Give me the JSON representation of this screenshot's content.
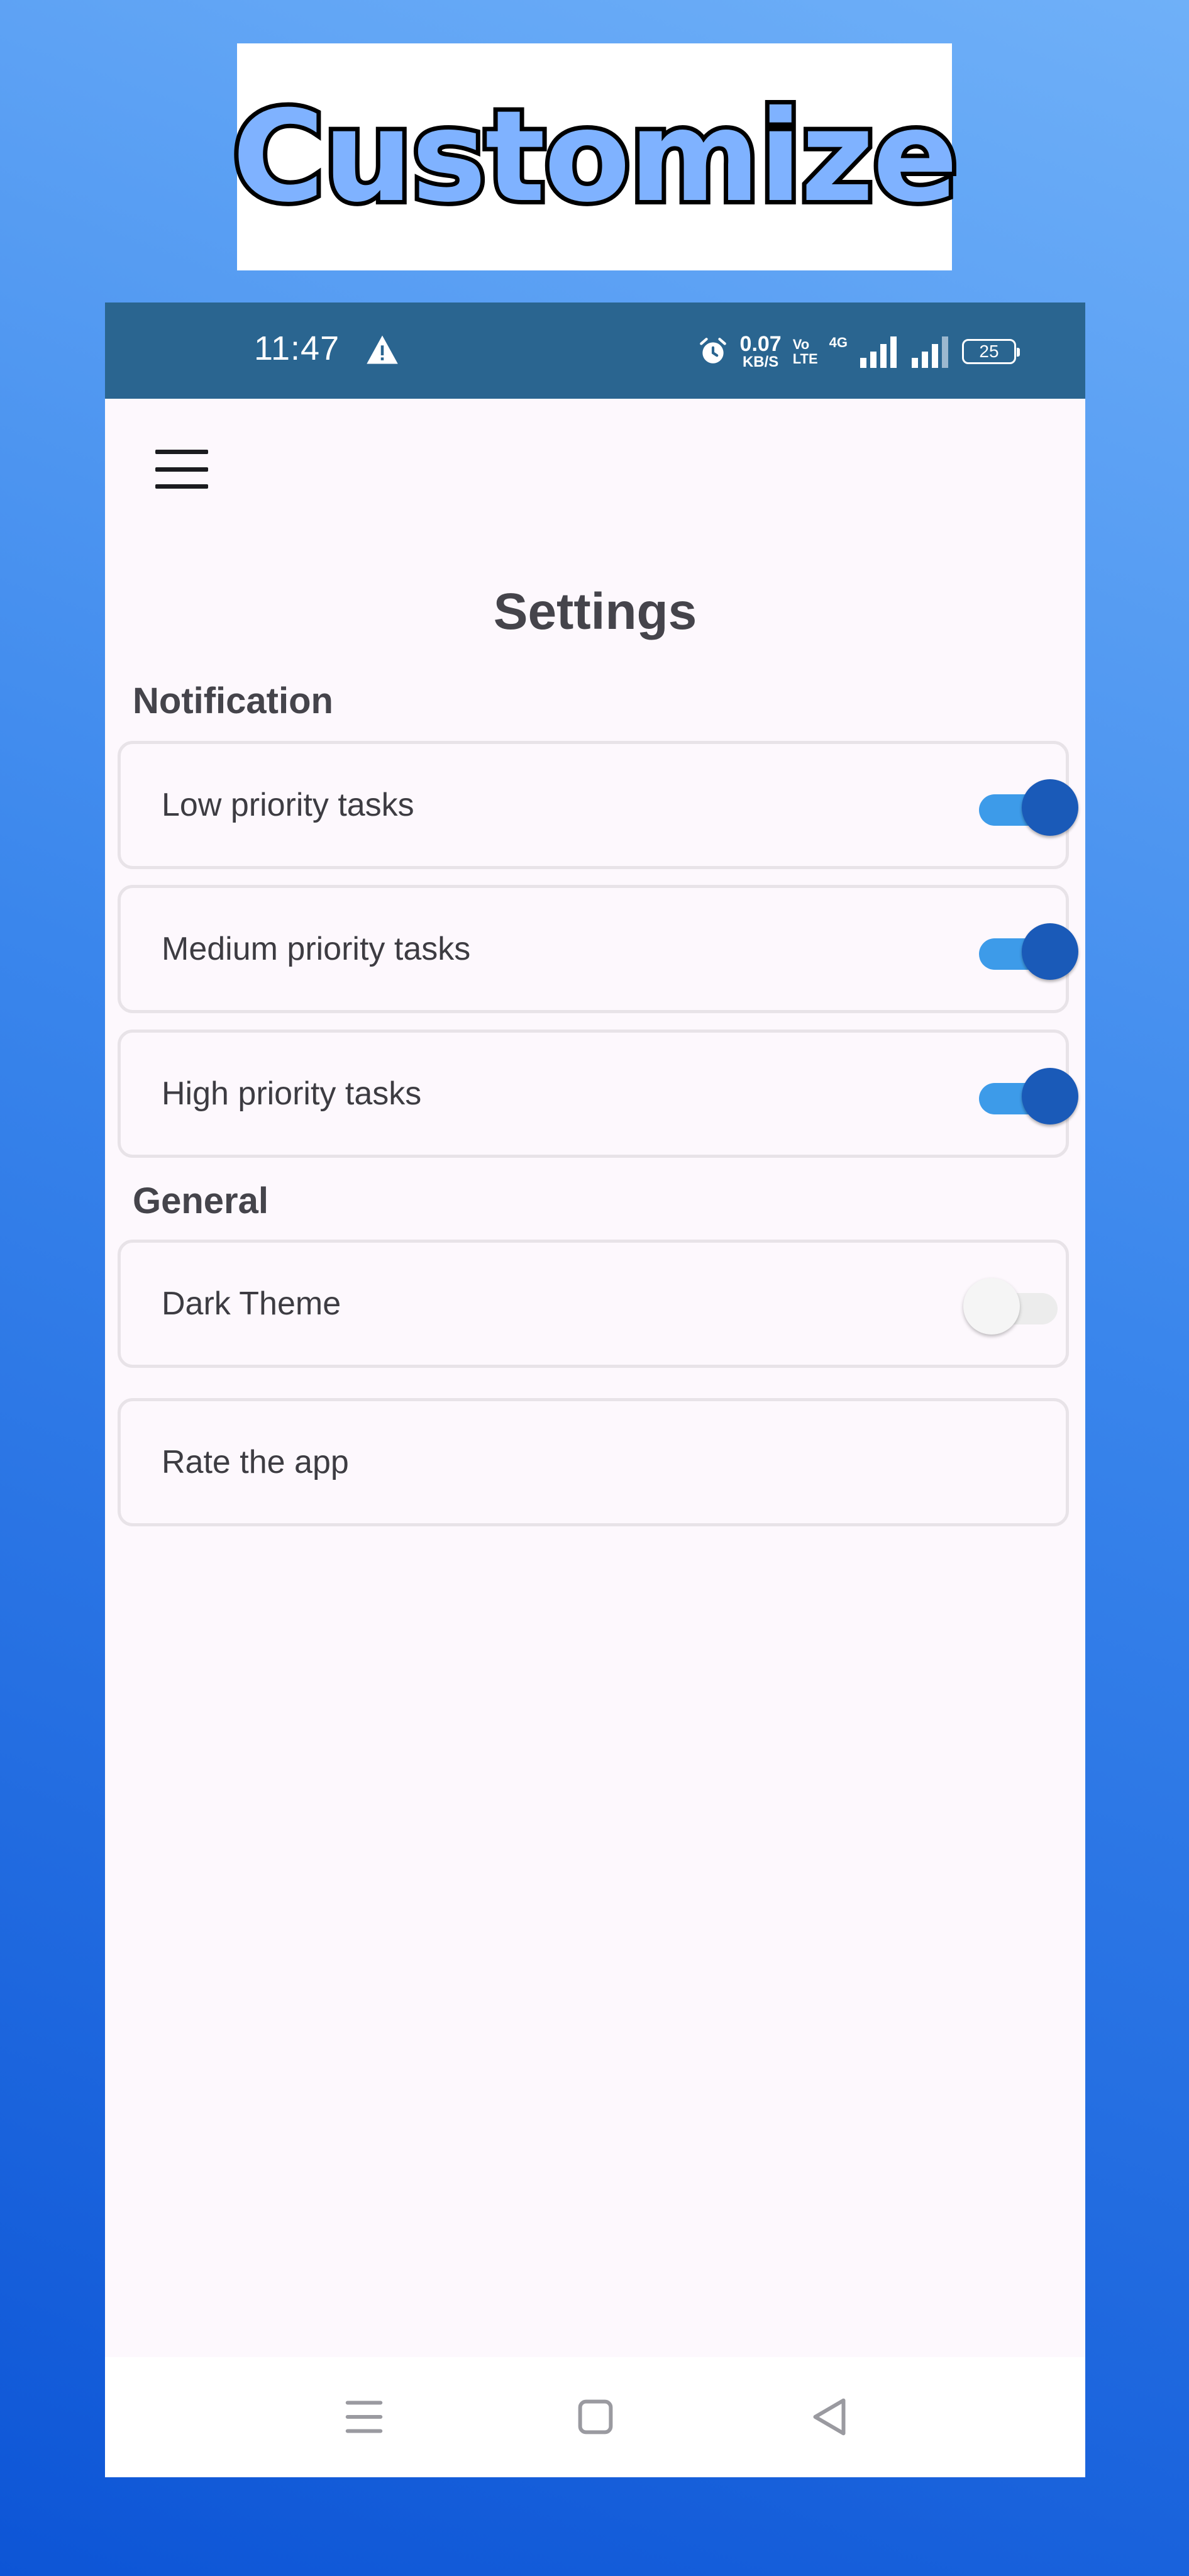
{
  "banner": {
    "title": "Customize"
  },
  "status_bar": {
    "time": "11:47",
    "net_speed_value": "0.07",
    "net_speed_unit": "KB/S",
    "volte_top": "Vo",
    "volte_bottom": "LTE",
    "network_type": "4G",
    "battery_level": "25",
    "icons": [
      "warning-icon",
      "alarm-icon",
      "signal-icon",
      "battery-icon"
    ]
  },
  "app": {
    "menu_icon": "menu-icon",
    "title": "Settings",
    "sections": [
      {
        "title": "Notification",
        "items": [
          {
            "label": "Low priority tasks",
            "toggle": true
          },
          {
            "label": "Medium priority tasks",
            "toggle": true
          },
          {
            "label": "High priority tasks",
            "toggle": true
          }
        ]
      },
      {
        "title": "General",
        "items": [
          {
            "label": "Dark Theme",
            "toggle": false
          },
          {
            "label": "Rate the app"
          }
        ]
      }
    ]
  },
  "nav_bar": {
    "icons": [
      "recents-icon",
      "home-icon",
      "back-icon"
    ]
  },
  "colors": {
    "status_bar": "#2a6590",
    "toggle_track_on": "#3d9be9",
    "toggle_knob_on": "#1a5ab8",
    "banner_text": "#7fb2ff",
    "background_top": "#6fb0f8",
    "background_bottom": "#0d55d6"
  }
}
